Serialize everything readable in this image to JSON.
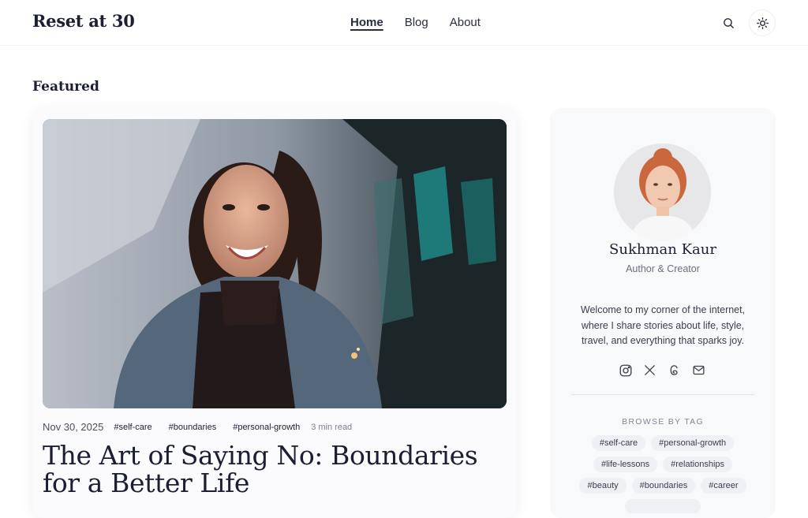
{
  "site": {
    "title": "Reset at 30"
  },
  "nav": {
    "items": [
      {
        "label": "Home"
      },
      {
        "label": "Blog"
      },
      {
        "label": "About"
      }
    ]
  },
  "header": {
    "search_icon": "search-icon",
    "theme_icon": "sun-icon"
  },
  "featured": {
    "section_title": "Featured",
    "post": {
      "date": "Nov 30, 2025",
      "tags": [
        "#self-care",
        "#boundaries",
        "#personal-growth"
      ],
      "read_time": "3 min read",
      "title": "The Art of Saying No: Boundaries for a Better Life"
    }
  },
  "sidebar": {
    "author_name": "Sukhman Kaur",
    "author_role": "Author & Creator",
    "bio": "Welcome to my corner of the internet, where I share stories about life, style, travel, and everything that sparks joy.",
    "socials": [
      "instagram-icon",
      "x-icon",
      "threads-icon",
      "mail-icon"
    ],
    "browse_label": "BROWSE BY TAG",
    "tags": [
      "#self-care",
      "#personal-growth",
      "#life-lessons",
      "#relationships",
      "#beauty",
      "#boundaries",
      "#career",
      ""
    ]
  },
  "colors": {
    "text": "#1c1f33",
    "muted": "#6b6f7d",
    "pill_bg": "#eef0f4",
    "sidebar_bg": "#f8f9fb"
  }
}
